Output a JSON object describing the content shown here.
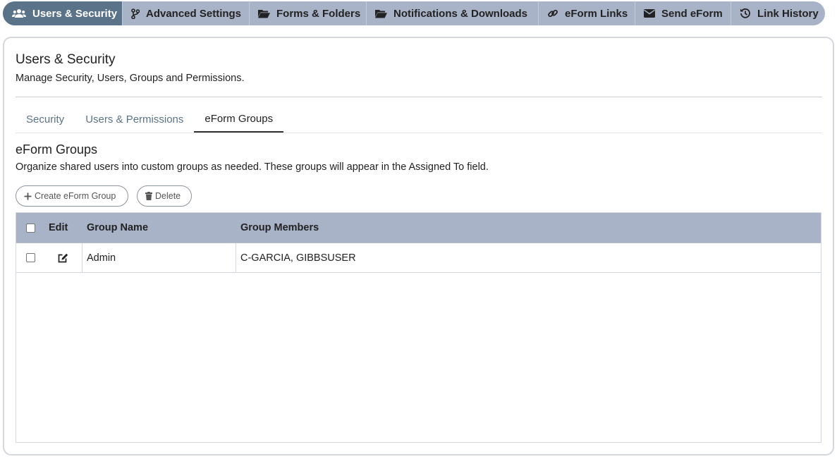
{
  "nav": {
    "items": [
      {
        "label": "Users & Security",
        "icon": "users-icon",
        "active": true
      },
      {
        "label": "Advanced Settings",
        "icon": "code-branch-icon",
        "active": false
      },
      {
        "label": "Forms & Folders",
        "icon": "folder-open-icon",
        "active": false
      },
      {
        "label": "Notifications & Downloads",
        "icon": "folder-open-icon",
        "active": false
      },
      {
        "label": "eForm Links",
        "icon": "link-icon",
        "active": false
      },
      {
        "label": "Send eForm",
        "icon": "envelope-icon",
        "active": false
      },
      {
        "label": "Link History",
        "icon": "history-icon",
        "active": false
      }
    ]
  },
  "page": {
    "title": "Users & Security",
    "subtitle": "Manage Security, Users, Groups and Permissions."
  },
  "tabs": [
    {
      "label": "Security",
      "active": false
    },
    {
      "label": "Users & Permissions",
      "active": false
    },
    {
      "label": "eForm Groups",
      "active": true
    }
  ],
  "section": {
    "title": "eForm Groups",
    "description": "Organize shared users into custom groups as needed. These groups will appear in the Assigned To field."
  },
  "toolbar": {
    "create_label": "Create eForm Group",
    "delete_label": "Delete"
  },
  "grid": {
    "columns": {
      "edit": "Edit",
      "name": "Group Name",
      "members": "Group Members"
    },
    "rows": [
      {
        "name": "Admin",
        "members": "C-GARCIA, GIBBSUSER",
        "checked": false
      }
    ]
  },
  "colors": {
    "nav_bg": "#a8b3c7",
    "nav_active": "#5b7388",
    "tab_link": "#5b7388",
    "grid_header": "#a8b3c7"
  }
}
